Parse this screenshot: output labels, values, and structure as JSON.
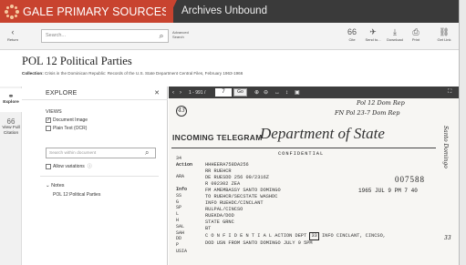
{
  "header": {
    "brand": "GALE PRIMARY SOURCES",
    "product": "Archives Unbound"
  },
  "toolbar": {
    "return_label": "Return",
    "search_placeholder": "Search...",
    "advanced_label": "Advanced Search",
    "actions": [
      {
        "icon": "cite-icon",
        "label": "Cite"
      },
      {
        "icon": "send-icon",
        "label": "Send to..."
      },
      {
        "icon": "download-icon",
        "label": "Download"
      },
      {
        "icon": "print-icon",
        "label": "Print"
      },
      {
        "icon": "link-icon",
        "label": "Get Link"
      }
    ]
  },
  "document": {
    "title": "POL 12 Political Parties",
    "collection_label": "Collection:",
    "collection": "Crisis in the Dominican Republic: Records of the U.S. State Department Central Files, February 1963-1966"
  },
  "rail": {
    "explore": "Explore",
    "view_full_citation": "View Full Citation"
  },
  "explore": {
    "title": "EXPLORE",
    "views_heading": "VIEWS",
    "document_image": "Document Image",
    "plain_text": "Plain Text (OCR)",
    "search_within_placeholder": "Search within document",
    "allow_variations": "Allow variations",
    "notes_heading": "Notes",
    "notes_item": "POL 12 Political Parties"
  },
  "viewer": {
    "page_range": "1 - 991 /",
    "page_value": "7",
    "go_label": "Go"
  },
  "telegram": {
    "circle_num": "43",
    "label": "INCOMING TELEGRAM",
    "dept": "Department of State",
    "handwritten1": "Pol 12 Dom Rep",
    "handwritten2": "FN Pol 23-7 Dom Rep",
    "confidential": "CONFIDENTIAL",
    "left_col": [
      "34",
      "Action",
      "",
      "ARA",
      "",
      "Info",
      "SS",
      "G",
      "SP",
      "L",
      "H",
      "SAL",
      "SAH",
      "DD",
      "P",
      "USIA"
    ],
    "body_lines": [
      "HHHEERA758DA256",
      "RR RUEHCR",
      "DE RUESDD 256 09/2316Z",
      "R 092302 ZEA",
      "FM AMEMBASSY SANTO DOMINGO",
      "TO RUEHCR/SECSTATE WASHDC",
      "INFO RUEHDC/CINCLANT",
      "RULPAL/CINCSO",
      "RUEKDA/DOD",
      "STATE GRNC",
      "BT",
      "C O N F I D E N T I A L  ACTION DEPT",
      "DOD USN FROM SANTO DOMINGO JULY 9 5PM"
    ],
    "action_tail": "INFO CINCLANT, CINCSO,",
    "box_num": "33",
    "stamp_num": "007588",
    "received": "1965 JUL 9 PM 7 40",
    "side_stamp": "Santo Domingo",
    "side_num": "33"
  }
}
